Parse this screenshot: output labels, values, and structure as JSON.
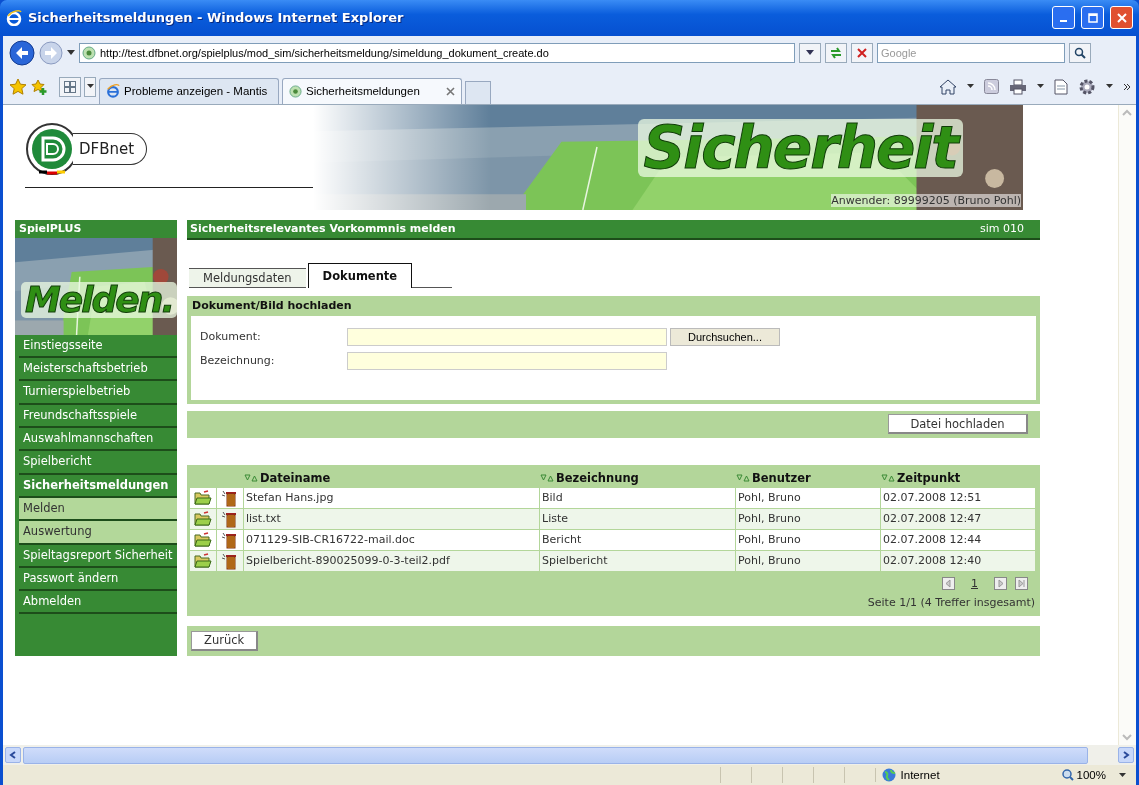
{
  "window": {
    "title": "Sicherheitsmeldungen - Windows Internet Explorer"
  },
  "address_bar": {
    "url": "http://test.dfbnet.org/spielplus/mod_sim/sicherheitsmeldung/simeldung_dokument_create.do"
  },
  "search": {
    "placeholder": "Google"
  },
  "browser_tabs": [
    {
      "label": "Probleme anzeigen - Mantis",
      "selected": false
    },
    {
      "label": "Sicherheitsmeldungen",
      "selected": true
    }
  ],
  "header": {
    "logo_text": "DFBnet",
    "banner_title": "Sicherheit",
    "user": "Anwender: 89999205 (Bruno Pohl)"
  },
  "sidebar": {
    "title": "SpielPLUS",
    "picture_caption": "Melden.",
    "items": [
      {
        "label": "Einstiegsseite",
        "kind": "item",
        "selected": false
      },
      {
        "label": "Meisterschaftsbetrieb",
        "kind": "item",
        "selected": false
      },
      {
        "label": "Turnierspielbetrieb",
        "kind": "item",
        "selected": false
      },
      {
        "label": "Freundschaftsspiele",
        "kind": "item",
        "selected": false
      },
      {
        "label": "Auswahlmannschaften",
        "kind": "item",
        "selected": false
      },
      {
        "label": "Spielbericht",
        "kind": "item",
        "selected": false
      },
      {
        "label": "Sicherheitsmeldungen",
        "kind": "item",
        "selected": true
      },
      {
        "label": "Melden",
        "kind": "subitem",
        "selected": false
      },
      {
        "label": "Auswertung",
        "kind": "subitem",
        "selected": false
      },
      {
        "label": "Spieltagsreport Sicherheit",
        "kind": "item",
        "selected": false
      },
      {
        "label": "Passwort ändern",
        "kind": "item",
        "selected": false
      },
      {
        "label": "Abmelden",
        "kind": "item",
        "selected": false
      }
    ]
  },
  "main": {
    "title": "Sicherheitsrelevantes Vorkommnis melden",
    "code": "sim 010",
    "tabs": [
      {
        "label": "Meldungsdaten",
        "selected": false
      },
      {
        "label": "Dokumente",
        "selected": true
      }
    ],
    "upload": {
      "title": "Dokument/Bild hochladen",
      "document_label": "Dokument:",
      "browse_button": "Durchsuchen...",
      "name_label": "Bezeichnung:",
      "submit_button": "Datei hochladen"
    },
    "table": {
      "columns": [
        "Dateiname",
        "Bezeichnung",
        "Benutzer",
        "Zeitpunkt"
      ],
      "rows": [
        [
          "Stefan Hans.jpg",
          "Bild",
          "Pohl, Bruno",
          "02.07.2008 12:51"
        ],
        [
          "list.txt",
          "Liste",
          "Pohl, Bruno",
          "02.07.2008 12:47"
        ],
        [
          "071129-SIB-CR16722-mail.doc",
          "Bericht",
          "Pohl, Bruno",
          "02.07.2008 12:44"
        ],
        [
          "Spielbericht-890025099-0-3-teil2.pdf",
          "Spielbericht",
          "Pohl, Bruno",
          "02.07.2008 12:40"
        ]
      ],
      "page": "1",
      "summary": "Seite 1/1 (4 Treffer insgesamt)"
    },
    "back_button": "Zurück"
  },
  "status_bar": {
    "zone": "Internet",
    "zoom": "100%"
  }
}
